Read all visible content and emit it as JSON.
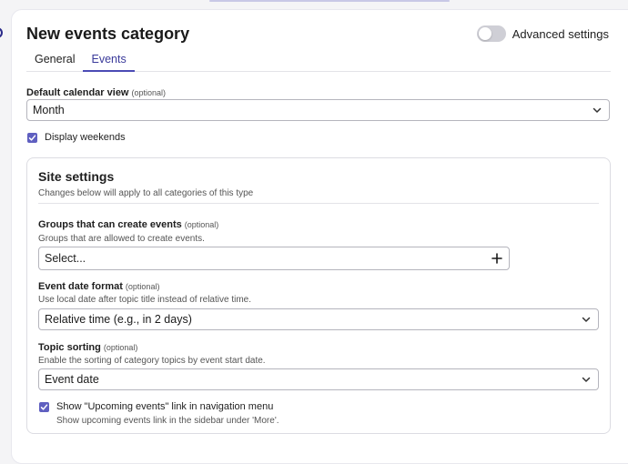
{
  "header": {
    "title": "New events category",
    "advanced_label": "Advanced settings",
    "advanced_enabled": false
  },
  "tabs": [
    {
      "label": "General",
      "active": false
    },
    {
      "label": "Events",
      "active": true
    }
  ],
  "default_view": {
    "label": "Default calendar view",
    "optional": "(optional)",
    "value": "Month"
  },
  "weekends": {
    "label": "Display weekends",
    "checked": true
  },
  "site": {
    "title": "Site settings",
    "description": "Changes below will apply to all categories of this type",
    "groups": {
      "label": "Groups that can create events",
      "optional": "(optional)",
      "help": "Groups that are allowed to create events.",
      "placeholder": "Select..."
    },
    "date_format": {
      "label": "Event date format",
      "optional": "(optional)",
      "help": "Use local date after topic title instead of relative time.",
      "value": "Relative time (e.g., in 2 days)"
    },
    "sorting": {
      "label": "Topic sorting",
      "optional": "(optional)",
      "help": "Enable the sorting of category topics by event start date.",
      "value": "Event date"
    },
    "upcoming": {
      "label": "Show \"Upcoming events\" link in navigation menu",
      "help": "Show upcoming events link in the sidebar under 'More'.",
      "checked": true
    }
  },
  "colors": {
    "accent": "#4b4bb5",
    "checkbox": "#5f5fc0"
  }
}
